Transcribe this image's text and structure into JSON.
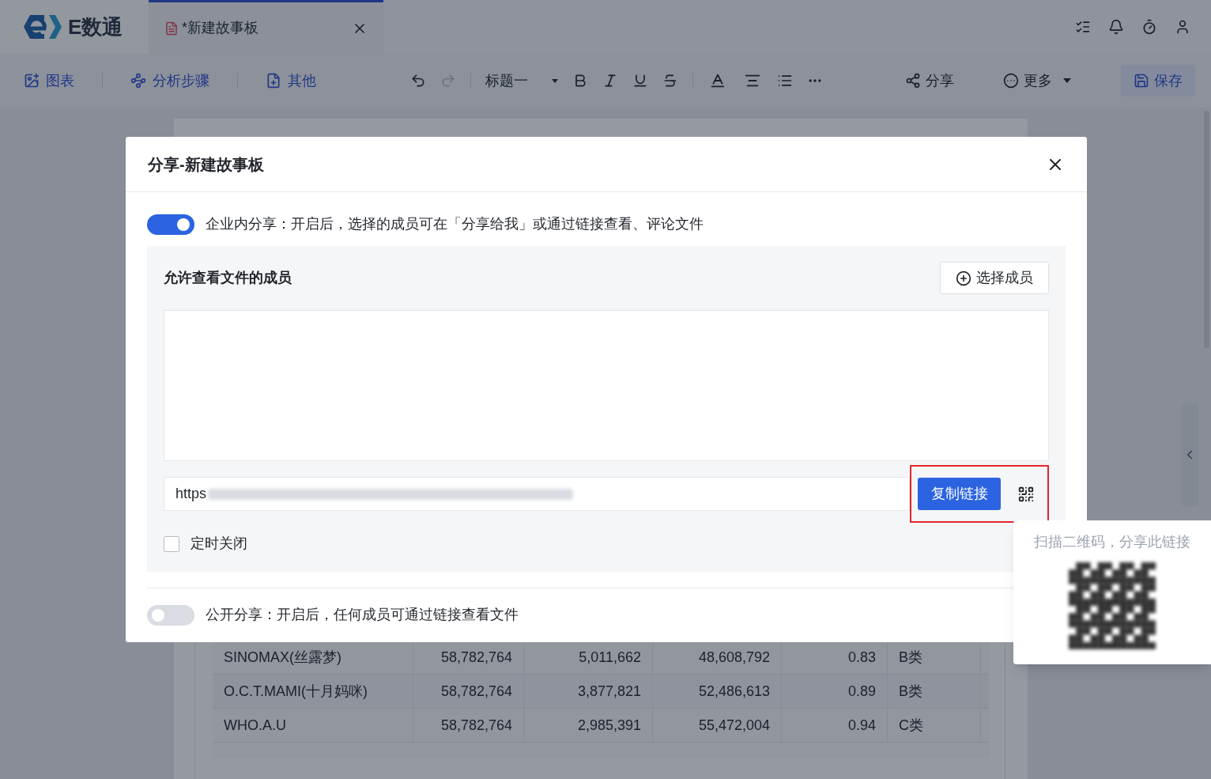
{
  "app": {
    "logo_text": "E数通",
    "tabs": [
      {
        "label": "*新建故事板",
        "selected": true
      }
    ]
  },
  "toolbar": {
    "groups": [
      {
        "label": "图表",
        "kind": "chart"
      },
      {
        "label": "分析步骤",
        "kind": "steps"
      },
      {
        "label": "其他",
        "kind": "other"
      }
    ],
    "heading_style": "标题一",
    "share": "分享",
    "more": "更多",
    "save": "保存"
  },
  "table": {
    "rows": [
      [
        "SINOMAX(丝露梦)",
        "58,782,764",
        "5,011,662",
        "48,608,792",
        "0.83",
        "B类"
      ],
      [
        "O.C.T.MAMI(十月妈咪)",
        "58,782,764",
        "3,877,821",
        "52,486,613",
        "0.89",
        "B类"
      ],
      [
        "WHO.A.U",
        "58,782,764",
        "2,985,391",
        "55,472,004",
        "0.94",
        "C类"
      ]
    ]
  },
  "dialog": {
    "title": "分享-新建故事板",
    "internal_share": {
      "on": true,
      "text": "企业内分享：开启后，选择的成员可在「分享给我」或通过链接查看、评论文件"
    },
    "members_heading": "允许查看文件的成员",
    "select_members": "选择成员",
    "link": "https",
    "copy_link": "复制链接",
    "timed_close": {
      "checked": false,
      "label": "定时关闭"
    },
    "public_share": {
      "on": false,
      "text": "公开分享：开启后，任何成员可通过链接查看文件"
    }
  },
  "qr_popover": {
    "text": "扫描二维码，分享此链接"
  }
}
